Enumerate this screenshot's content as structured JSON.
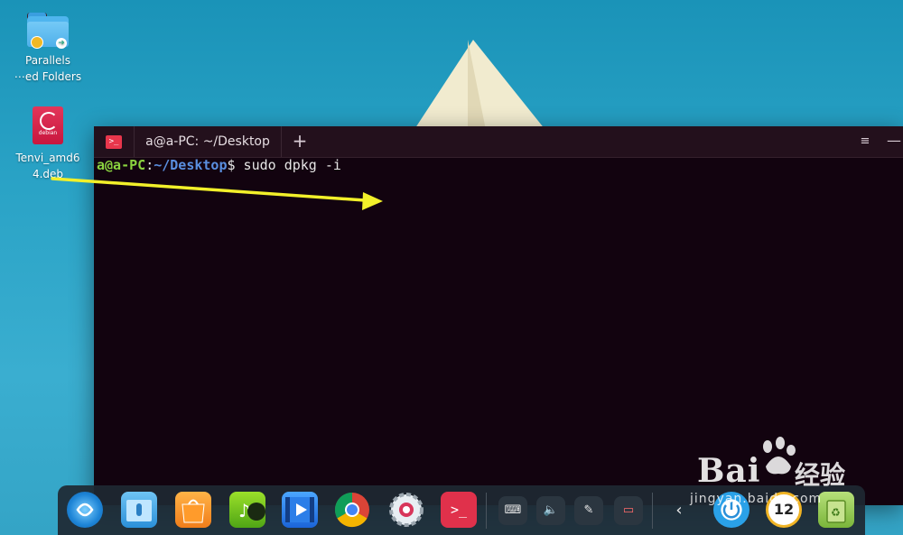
{
  "desktop": {
    "icons": [
      {
        "label_line1": "Parallels",
        "label_line2": "⋯ed Folders"
      },
      {
        "label_line1": "Tenvi_amd6",
        "label_line2": "4.deb",
        "badge_text": "debian"
      }
    ]
  },
  "terminal": {
    "tab_title": "a@a-PC: ~/Desktop",
    "new_tab_glyph": "+",
    "menu_glyph": "≡",
    "minimize_glyph": "—",
    "app_icon_glyph": ">_",
    "prompt_user": "a@a-PC",
    "prompt_colon": ":",
    "prompt_path": "~/Desktop",
    "prompt_symbol": "$",
    "command": " sudo dpkg -i"
  },
  "dock": {
    "apps": [
      "launcher-icon",
      "file-manager-icon",
      "app-store-icon",
      "music-icon",
      "video-icon",
      "chrome-icon",
      "settings-icon",
      "terminal-icon"
    ],
    "tray": [
      {
        "name": "keyboard-icon",
        "glyph": "⌨"
      },
      {
        "name": "volume-icon",
        "glyph": "🔈"
      },
      {
        "name": "pen-icon",
        "glyph": "✎"
      },
      {
        "name": "battery-icon",
        "glyph": "▭"
      },
      {
        "name": "chevron-left-icon",
        "glyph": "‹"
      }
    ],
    "clock_text": "12"
  },
  "watermark": {
    "brand": "Bai",
    "brand_cn": "经验",
    "url": "jingyan.baidu.com"
  },
  "colors": {
    "terminal_bg": "#12030f",
    "prompt_user": "#8ad33f",
    "prompt_path": "#5a8fe0",
    "arrow": "#f2f02a"
  }
}
